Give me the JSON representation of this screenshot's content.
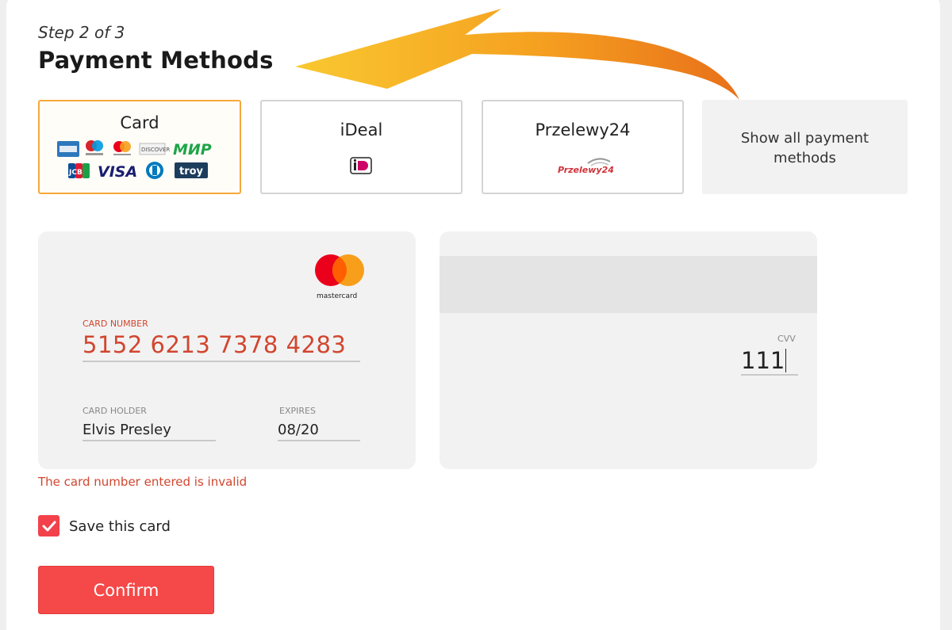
{
  "header": {
    "step": "Step 2 of 3",
    "title": "Payment Methods"
  },
  "payment_methods": [
    {
      "label": "Card",
      "selected": true,
      "logos": [
        "amex-logo",
        "maestro-logo",
        "mastercard-logo",
        "discover-logo",
        "mir-logo",
        "jcb-logo",
        "visa-logo",
        "diners-logo",
        "troy-logo"
      ]
    },
    {
      "label": "iDeal",
      "selected": false,
      "logos": [
        "ideal-logo"
      ]
    },
    {
      "label": "Przelewy24",
      "selected": false,
      "logos": [
        "przelewy24-logo"
      ]
    },
    {
      "label": "Show all payment methods",
      "selected": false
    }
  ],
  "card_logos": {
    "mir": "МИР",
    "visa": "VISA",
    "jcb": "JCB",
    "troy": "troy",
    "p24": "Przelewy24",
    "ideal": "iD"
  },
  "card_form": {
    "brand_logo": "mastercard",
    "brand_text": "mastercard",
    "card_number_label": "CARD NUMBER",
    "card_number": "5152 6213 7378 4283",
    "card_holder_label": "CARD HOLDER",
    "card_holder": "Elvis Presley",
    "expires_label": "EXPIRES",
    "expires": "08/20",
    "cvv_label": "CVV",
    "cvv": "111"
  },
  "error_message": "The card number entered is invalid",
  "save_card": {
    "label": "Save this card",
    "checked": true
  },
  "confirm_label": "Confirm",
  "colors": {
    "accent": "#f54848",
    "selected_border": "#f5a93a",
    "error": "#d1462f",
    "arrow": "#f5a020"
  }
}
